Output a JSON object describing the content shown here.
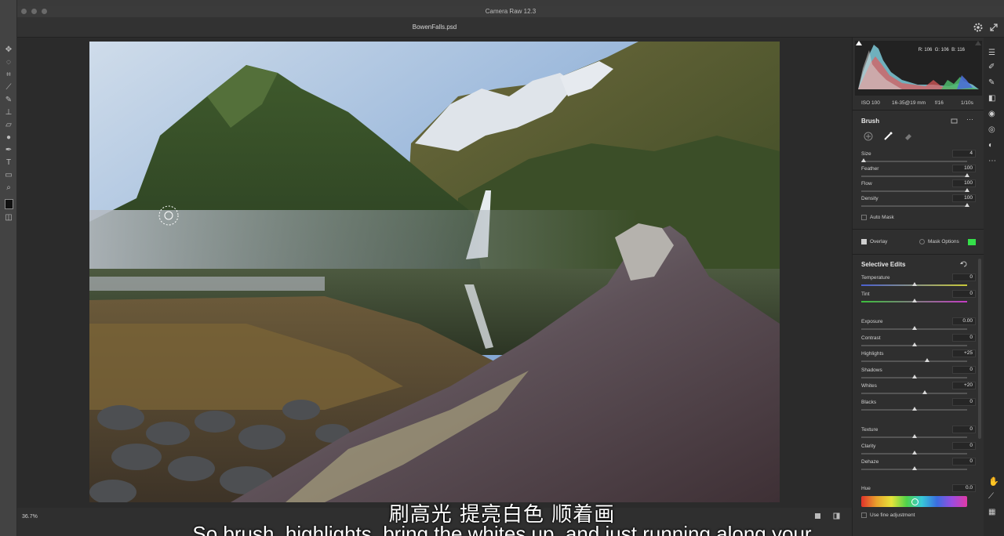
{
  "app_title": "Camera Raw 12.3",
  "file_name": "BowenFalls.psd",
  "histogram": {
    "r": "R: 106",
    "g": "G: 106",
    "b": "B: 116"
  },
  "camera_info": {
    "iso": "ISO 100",
    "lens": "16-35@19 mm",
    "aperture": "f/16",
    "shutter": "1/10s"
  },
  "brush": {
    "title": "Brush",
    "sliders": [
      {
        "label": "Size",
        "value": "4",
        "pos": 0.02
      },
      {
        "label": "Feather",
        "value": "100",
        "pos": 1.0
      },
      {
        "label": "Flow",
        "value": "100",
        "pos": 1.0
      },
      {
        "label": "Density",
        "value": "100",
        "pos": 1.0
      }
    ],
    "auto_mask": "Auto Mask",
    "overlay": "Overlay",
    "mask_options": "Mask Options",
    "mask_color": "#35e04a"
  },
  "selective_edits": {
    "title": "Selective Edits",
    "temperature": {
      "label": "Temperature",
      "value": "0",
      "pos": 0.5
    },
    "tint": {
      "label": "Tint",
      "value": "0",
      "pos": 0.5
    },
    "exposure": {
      "label": "Exposure",
      "value": "0.00",
      "pos": 0.5
    },
    "contrast": {
      "label": "Contrast",
      "value": "0",
      "pos": 0.5
    },
    "highlights": {
      "label": "Highlights",
      "value": "+25",
      "pos": 0.625
    },
    "shadows": {
      "label": "Shadows",
      "value": "0",
      "pos": 0.5
    },
    "whites": {
      "label": "Whites",
      "value": "+20",
      "pos": 0.6
    },
    "blacks": {
      "label": "Blacks",
      "value": "0",
      "pos": 0.5
    },
    "texture": {
      "label": "Texture",
      "value": "0",
      "pos": 0.5
    },
    "clarity": {
      "label": "Clarity",
      "value": "0",
      "pos": 0.5
    },
    "dehaze": {
      "label": "Dehaze",
      "value": "0",
      "pos": 0.5
    },
    "hue": {
      "label": "Hue",
      "value": "0.0"
    },
    "fine_adjustment": "Use fine adjustment"
  },
  "zoom": "36.7%",
  "subtitles": {
    "cn": "刷高光 提亮白色 顺着画",
    "en": "So brush, highlights, bring the whites up, and just running along your"
  }
}
